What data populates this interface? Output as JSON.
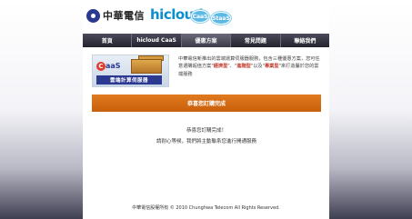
{
  "header": {
    "company": "中華電信",
    "product": "hicloud",
    "bubbles": [
      "CaaS",
      "StaaS"
    ]
  },
  "nav": {
    "items": [
      {
        "label": "首頁",
        "active": false
      },
      {
        "label": "hicloud CaaS",
        "active": false
      },
      {
        "label": "優惠方案",
        "active": true
      },
      {
        "label": "常見問題",
        "active": false
      },
      {
        "label": "聯絡我們",
        "active": false
      }
    ]
  },
  "banner": {
    "badge": "CaaS",
    "title": "雲端計算伺服器",
    "text_part1": "中華電信新推出的雲端運算伺服器服務，包含三種優惠方案，您可任意選購超值方案\"",
    "hl1": "經濟型",
    "text_part2": "\"、\"",
    "hl2": "進階型",
    "text_part3": "\"以及\"",
    "hl3": "專業型",
    "text_part4": "\"來打造屬於您的雲端服務"
  },
  "status_bar": {
    "label": "恭喜您訂購完成"
  },
  "message": {
    "line1": "恭喜您訂購完成！",
    "line2": "請耐心等候，我們將主動聯系您進行開通服務"
  },
  "footer": {
    "text": "中華電信股權所有 © 2010 Chunghwa Telecom All Rights Reserved."
  },
  "colors": {
    "nav_bg": "#2a2a36",
    "accent_orange": "#d96a14",
    "brand_blue": "#2b3990",
    "hicloud_blue": "#0c8ecf"
  }
}
